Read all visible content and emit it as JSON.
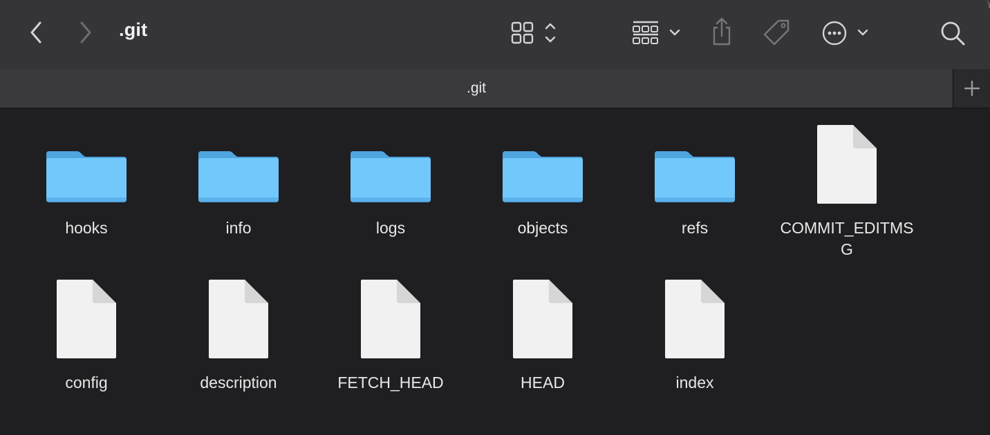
{
  "window": {
    "title": ".git"
  },
  "toolbar": {
    "back": "chevron-left-icon",
    "forward": "chevron-right-icon",
    "view": "grid-view-icon",
    "group": "group-by-icon",
    "share": "share-icon",
    "tag": "tag-icon",
    "more": "more-options-icon",
    "search": "search-icon"
  },
  "tabs": [
    {
      "label": ".git"
    }
  ],
  "colors": {
    "folder": "#6cc4f9",
    "folder_tab": "#5db4ec",
    "toolbar": "#353538",
    "background": "#1f1f22"
  },
  "files": [
    {
      "name": "hooks",
      "kind": "folder"
    },
    {
      "name": "info",
      "kind": "folder"
    },
    {
      "name": "logs",
      "kind": "folder"
    },
    {
      "name": "objects",
      "kind": "folder"
    },
    {
      "name": "refs",
      "kind": "folder"
    },
    {
      "name": "COMMIT_EDITMSG",
      "kind": "document"
    },
    {
      "name": "config",
      "kind": "document"
    },
    {
      "name": "description",
      "kind": "document"
    },
    {
      "name": "FETCH_HEAD",
      "kind": "document"
    },
    {
      "name": "HEAD",
      "kind": "document"
    },
    {
      "name": "index",
      "kind": "document"
    }
  ]
}
